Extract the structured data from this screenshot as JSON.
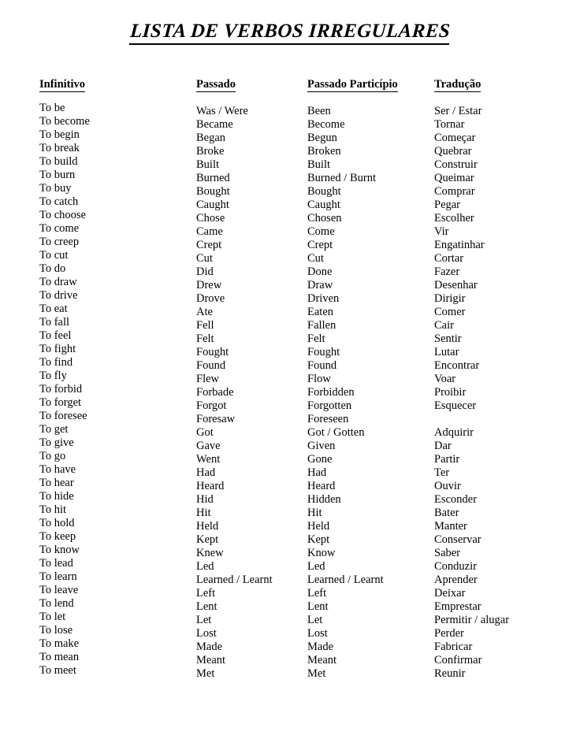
{
  "document": {
    "title": "LISTA DE VERBOS IRREGULARES"
  },
  "table": {
    "headers": [
      "Infinitivo",
      "Passado",
      "Passado Particípio",
      "Tradução"
    ],
    "rows": [
      {
        "infinitivo": "To be",
        "passado": "Was / Were",
        "participio": "Been",
        "traducao": "Ser / Estar"
      },
      {
        "infinitivo": "To become",
        "passado": "Became",
        "participio": "Become",
        "traducao": "Tornar"
      },
      {
        "infinitivo": "To begin",
        "passado": "Began",
        "participio": "Begun",
        "traducao": "Começar"
      },
      {
        "infinitivo": "To break",
        "passado": "Broke",
        "participio": "Broken",
        "traducao": "Quebrar"
      },
      {
        "infinitivo": "To build",
        "passado": "Built",
        "participio": "Built",
        "traducao": "Construir"
      },
      {
        "infinitivo": "To burn",
        "passado": "Burned",
        "participio": "Burned / Burnt",
        "traducao": "Queimar"
      },
      {
        "infinitivo": "To buy",
        "passado": "Bought",
        "participio": "Bought",
        "traducao": "Comprar"
      },
      {
        "infinitivo": "To catch",
        "passado": "Caught",
        "participio": "Caught",
        "traducao": "Pegar"
      },
      {
        "infinitivo": "To choose",
        "passado": "Chose",
        "participio": "Chosen",
        "traducao": "Escolher"
      },
      {
        "infinitivo": "To come",
        "passado": "Came",
        "participio": "Come",
        "traducao": "Vir"
      },
      {
        "infinitivo": "To creep",
        "passado": "Crept",
        "participio": "Crept",
        "traducao": "Engatinhar"
      },
      {
        "infinitivo": "To cut",
        "passado": "Cut",
        "participio": "Cut",
        "traducao": "Cortar"
      },
      {
        "infinitivo": "To do",
        "passado": "Did",
        "participio": "Done",
        "traducao": "Fazer"
      },
      {
        "infinitivo": "To draw",
        "passado": "Drew",
        "participio": "Draw",
        "traducao": "Desenhar"
      },
      {
        "infinitivo": "To drive",
        "passado": "Drove",
        "participio": "Driven",
        "traducao": "Dirigir"
      },
      {
        "infinitivo": "To eat",
        "passado": "Ate",
        "participio": "Eaten",
        "traducao": "Comer"
      },
      {
        "infinitivo": "To fall",
        "passado": "Fell",
        "participio": "Fallen",
        "traducao": "Cair"
      },
      {
        "infinitivo": "To feel",
        "passado": "Felt",
        "participio": "Felt",
        "traducao": "Sentir"
      },
      {
        "infinitivo": "To fight",
        "passado": "Fought",
        "participio": "Fought",
        "traducao": "Lutar"
      },
      {
        "infinitivo": "To find",
        "passado": "Found",
        "participio": "Found",
        "traducao": "Encontrar"
      },
      {
        "infinitivo": "To fly",
        "passado": "Flew",
        "participio": "Flow",
        "traducao": "Voar"
      },
      {
        "infinitivo": "To forbid",
        "passado": "Forbade",
        "participio": "Forbidden",
        "traducao": "Proibir"
      },
      {
        "infinitivo": "To forget",
        "passado": "Forgot",
        "participio": "Forgotten",
        "traducao": "Esquecer"
      },
      {
        "infinitivo": "To foresee",
        "passado": "Foresaw",
        "participio": "Foreseen",
        "traducao": ""
      },
      {
        "infinitivo": "To get",
        "passado": "Got",
        "participio": "Got / Gotten",
        "traducao": "Adquirir"
      },
      {
        "infinitivo": "To give",
        "passado": "Gave",
        "participio": "Given",
        "traducao": "Dar"
      },
      {
        "infinitivo": "To go",
        "passado": "Went",
        "participio": "Gone",
        "traducao": "Partir"
      },
      {
        "infinitivo": "To have",
        "passado": "Had",
        "participio": "Had",
        "traducao": "Ter"
      },
      {
        "infinitivo": "To hear",
        "passado": "Heard",
        "participio": "Heard",
        "traducao": "Ouvir"
      },
      {
        "infinitivo": "To hide",
        "passado": "Hid",
        "participio": "Hidden",
        "traducao": "Esconder"
      },
      {
        "infinitivo": "To hit",
        "passado": "Hit",
        "participio": "Hit",
        "traducao": "Bater"
      },
      {
        "infinitivo": "To hold",
        "passado": "Held",
        "participio": "Held",
        "traducao": "Manter"
      },
      {
        "infinitivo": "To keep",
        "passado": "Kept",
        "participio": "Kept",
        "traducao": "Conservar"
      },
      {
        "infinitivo": "To know",
        "passado": "Knew",
        "participio": "Know",
        "traducao": "Saber"
      },
      {
        "infinitivo": "To lead",
        "passado": "Led",
        "participio": "Led",
        "traducao": "Conduzir"
      },
      {
        "infinitivo": "To learn",
        "passado": "Learned / Learnt",
        "participio": "Learned / Learnt",
        "traducao": "Aprender"
      },
      {
        "infinitivo": "To leave",
        "passado": "Left",
        "participio": "Left",
        "traducao": "Deixar"
      },
      {
        "infinitivo": "To lend",
        "passado": "Lent",
        "participio": "Lent",
        "traducao": "Emprestar"
      },
      {
        "infinitivo": "To let",
        "passado": "Let",
        "participio": "Let",
        "traducao": "Permitir / alugar"
      },
      {
        "infinitivo": "To lose",
        "passado": "Lost",
        "participio": "Lost",
        "traducao": "Perder"
      },
      {
        "infinitivo": "To make",
        "passado": "Made",
        "participio": "Made",
        "traducao": "Fabricar"
      },
      {
        "infinitivo": "To mean",
        "passado": "Meant",
        "participio": "Meant",
        "traducao": "Confirmar"
      },
      {
        "infinitivo": "To meet",
        "passado": "Met",
        "participio": "Met",
        "traducao": "Reunir"
      }
    ]
  }
}
